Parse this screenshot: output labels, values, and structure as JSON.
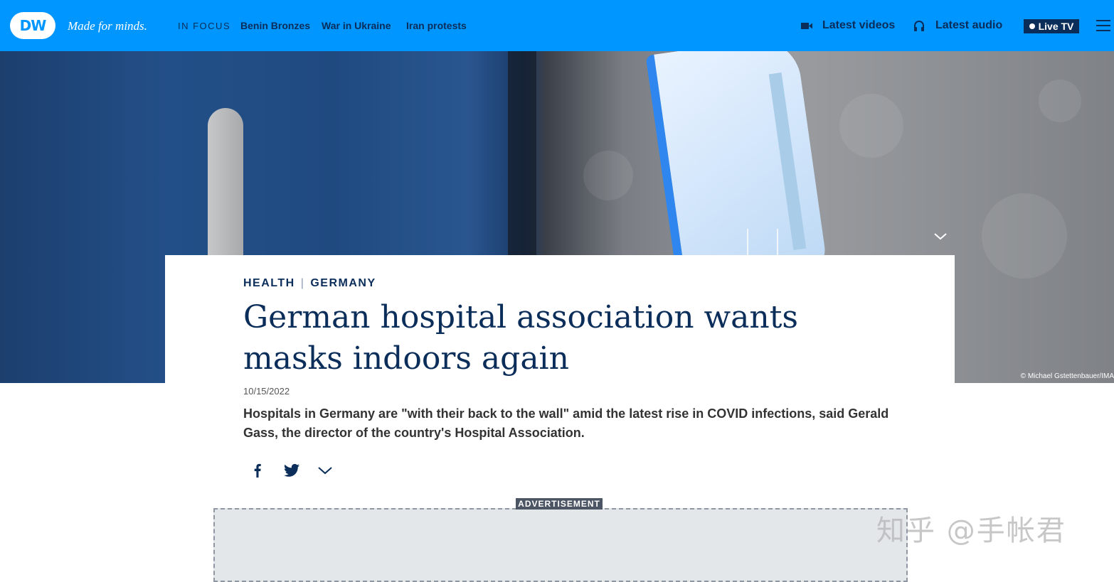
{
  "header": {
    "logo_text": "DW",
    "tagline": "Made for minds.",
    "focus_label": "IN FOCUS",
    "focus_links": [
      "Benin Bronzes",
      "War in Ukraine",
      "Iran protests"
    ],
    "latest_videos": "Latest videos",
    "latest_audio": "Latest audio",
    "live_tv": "Live TV",
    "colors": {
      "brand_blue": "#0096ff",
      "navy": "#0a2d59"
    }
  },
  "hero": {
    "photo_credit": "© Michael Gstettenbauer/IMA"
  },
  "article": {
    "kicker_1": "HEALTH",
    "kicker_sep": "|",
    "kicker_2": "GERMANY",
    "headline": "German hospital association wants masks indoors again",
    "date": "10/15/2022",
    "teaser": "Hospitals in Germany are \"with their back to the wall\" amid the latest rise in COVID infections, said Gerald Gass, the director of the country's Hospital Association."
  },
  "share": {
    "icons": [
      "facebook-icon",
      "twitter-icon",
      "chevron-down-icon"
    ]
  },
  "advertisement": {
    "label": "ADVERTISEMENT"
  },
  "watermark": {
    "text": "知乎 @手帐君"
  }
}
